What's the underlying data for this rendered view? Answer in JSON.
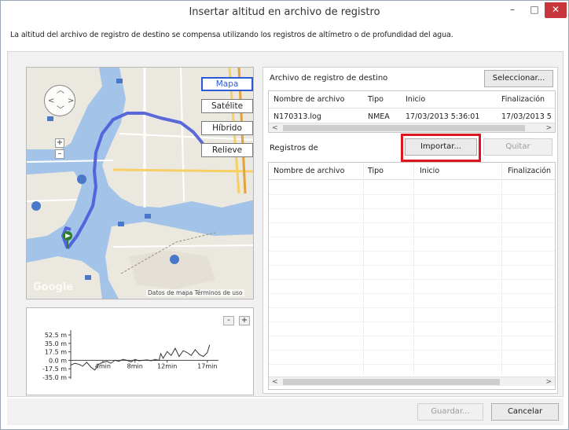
{
  "window": {
    "title": "Insertar altitud en archivo de registro",
    "minimize_glyph": "–",
    "maximize_glyph": "□",
    "close_glyph": "✕"
  },
  "description": "La altitud del archivo de registro de destino se compensa utilizando los registros de altímetro o de profundidad del agua.",
  "map": {
    "types": [
      "Mapa",
      "Satélite",
      "Híbrido",
      "Relieve"
    ],
    "active_type": "Mapa",
    "attribution": "Datos de mapa   Términos de uso",
    "logo": "Google",
    "zoom_in_glyph": "+",
    "zoom_out_glyph": "–",
    "pan_glyphs": {
      "up": "︿",
      "left": "<",
      "right": ">",
      "down": "﹀"
    },
    "route_color": "#4a5bd8",
    "water_color": "#a3c3e8",
    "land_color": "#ebe8e0"
  },
  "altitude_chart": {
    "zoom_out_label": "-",
    "zoom_in_label": "+",
    "chart_data": {
      "type": "line",
      "y_tick_labels": [
        "52.5 m",
        "35.0 m",
        "17.5 m",
        "0.0 m",
        "-17.5 m",
        "-35.0 m"
      ],
      "x_tick_labels": [
        "4min",
        "8min",
        "12min",
        "17min"
      ],
      "ylim": [
        -35,
        52.5
      ],
      "xlim": [
        0,
        18
      ],
      "series": [
        {
          "x": [
            0,
            0.5,
            1,
            1.5,
            2,
            2.5,
            3,
            3.5,
            4,
            4.5,
            5,
            5.5,
            6,
            6.5,
            7,
            7.5,
            8,
            8.5,
            9,
            9.5,
            10,
            10.5,
            11,
            11.2,
            11.5,
            12,
            12.5,
            13,
            13.5,
            14,
            14.5,
            15,
            15.5,
            16,
            16.5,
            17,
            17.3
          ],
          "y": [
            -10,
            -6,
            -8,
            -12,
            -4,
            -14,
            -20,
            -8,
            -4,
            -2,
            -6,
            0,
            -2,
            2,
            0,
            -3,
            2,
            -1,
            0,
            1,
            -1,
            2,
            0,
            14,
            4,
            18,
            10,
            25,
            8,
            20,
            16,
            10,
            22,
            12,
            8,
            16,
            32
          ]
        }
      ],
      "grid": false
    }
  },
  "target": {
    "section_label": "Archivo de registro de destino",
    "select_button": "Seleccionar...",
    "columns": [
      "Nombre de archivo",
      "Tipo",
      "Inicio",
      "Finalización"
    ],
    "rows": [
      [
        "N170313.log",
        "NMEA",
        "17/03/2013 5:36:01",
        "17/03/2013 5"
      ]
    ]
  },
  "sources": {
    "section_label": "Registros de",
    "import_button": "Importar...",
    "remove_button": "Quitar",
    "columns": [
      "Nombre de archivo",
      "Tipo",
      "Inicio",
      "Finalización"
    ],
    "rows": []
  },
  "scroll": {
    "left_glyph": "<",
    "right_glyph": ">"
  },
  "footer": {
    "save_button": "Guardar...",
    "cancel_button": "Cancelar"
  },
  "colors": {
    "highlight": "#e0141e",
    "close_button": "#c7363b",
    "active_map_type": "#2c59d8"
  }
}
